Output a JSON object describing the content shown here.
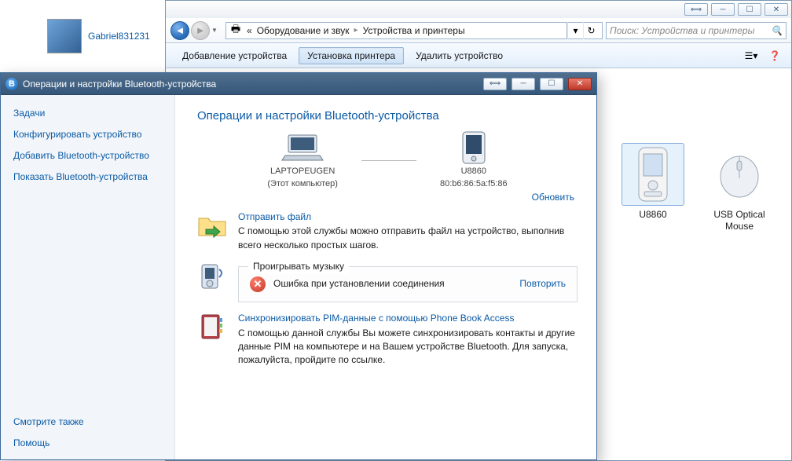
{
  "user": {
    "name": "Gabriel831231"
  },
  "explorer": {
    "window_buttons": {
      "ghost": "⟺",
      "min": "─",
      "max": "☐",
      "close": "✕"
    },
    "breadcrumb": {
      "seg1": "Оборудование и звук",
      "seg2": "Устройства и принтеры",
      "chev": "«",
      "sep": "▸"
    },
    "search_placeholder": "Поиск: Устройства и принтеры",
    "toolbar": {
      "add_device": "Добавление устройства",
      "add_printer": "Установка принтера",
      "remove_device": "Удалить устройство"
    },
    "devices": {
      "phone": "U8860",
      "mouse_line1": "USB Optical",
      "mouse_line2": "Mouse"
    }
  },
  "bluetooth": {
    "title": "Операции и настройки Bluetooth-устройства",
    "buttons": {
      "ghost": "⟺",
      "min": "─",
      "max": "☐",
      "close": "✕"
    },
    "sidebar": {
      "tasks_header": "Задачи",
      "configure": "Конфигурировать устройство",
      "add": "Добавить Bluetooth-устройство",
      "show": "Показать Bluetooth-устройства",
      "see_also": "Смотрите также",
      "help": "Помощь"
    },
    "heading": "Операции и настройки Bluetooth-устройства",
    "devices": {
      "laptop_name": "LAPTOPEUGEN",
      "laptop_sub": "(Этот компьютер)",
      "phone_name": "U8860",
      "phone_mac": "80:b6:86:5a:f5:86"
    },
    "refresh": "Обновить",
    "send_file": {
      "title": "Отправить файл",
      "desc": "С помощью этой службы можно отправить файл на устройство, выполнив всего несколько простых шагов."
    },
    "music": {
      "legend": "Проигрывать музыку",
      "error": "Ошибка при установлении соединения",
      "retry": "Повторить"
    },
    "pim": {
      "title": "Синхронизировать PIM-данные с помощью Phone Book Access",
      "desc": "С помощью данной службы Вы можете синхронизировать контакты и другие данные PIM на компьютере и на Вашем устройстве Bluetooth. Для запуска, пожалуйста, пройдите по ссылке."
    }
  }
}
